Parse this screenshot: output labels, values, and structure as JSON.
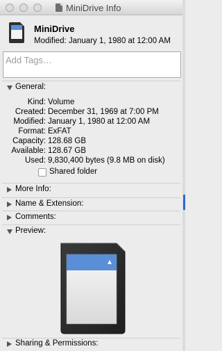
{
  "window": {
    "title": "MiniDrive Info"
  },
  "header": {
    "name": "MiniDrive",
    "modified": "Modified: January 1, 1980 at 12:00 AM"
  },
  "tags": {
    "placeholder": "Add Tags…"
  },
  "sections": {
    "general": "General:",
    "more_info": "More Info:",
    "name_extension": "Name & Extension:",
    "comments": "Comments:",
    "preview": "Preview:",
    "sharing": "Sharing & Permissions:"
  },
  "general": {
    "kind_label": "Kind:",
    "kind": "Volume",
    "created_label": "Created:",
    "created": "December 31, 1969 at 7:00 PM",
    "modified_label": "Modified:",
    "modified": "January 1, 1980 at 12:00 AM",
    "format_label": "Format:",
    "format": "ExFAT",
    "capacity_label": "Capacity:",
    "capacity": "128.68 GB",
    "available_label": "Available:",
    "available": "128.67 GB",
    "used_label": "Used:",
    "used": "9,830,400 bytes (9.8 MB on disk)",
    "shared_folder_label": "Shared folder",
    "shared_folder_checked": false
  },
  "colors": {
    "window_bg": "#ececec",
    "card_label": "#5a8ed6",
    "card_body": "#2f2f2f"
  },
  "icons": {
    "volume": "sd-card-icon",
    "disclosure_open": "triangle-down-icon",
    "disclosure_closed": "triangle-right-icon"
  }
}
